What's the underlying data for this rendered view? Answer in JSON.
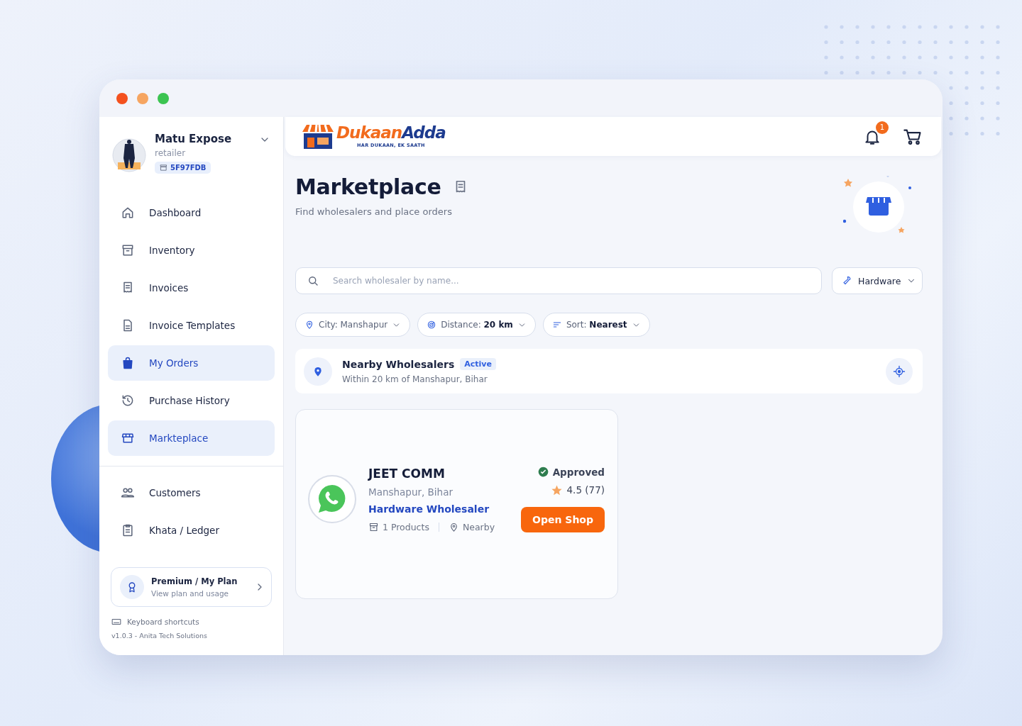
{
  "user": {
    "name": "Matu Expose",
    "role": "retailer",
    "code": "5F97FDB"
  },
  "sidebar": {
    "items": [
      {
        "label": "Dashboard",
        "selected": false
      },
      {
        "label": "Inventory",
        "selected": false
      },
      {
        "label": "Invoices",
        "selected": false
      },
      {
        "label": "Invoice Templates",
        "selected": false
      },
      {
        "label": "My Orders",
        "selected": true
      },
      {
        "label": "Purchase History",
        "selected": false
      },
      {
        "label": "Markteplace",
        "selected": true
      }
    ],
    "secondary_items": [
      {
        "label": "Customers",
        "selected": false
      },
      {
        "label": "Khata / Ledger",
        "selected": false
      }
    ],
    "plan": {
      "title": "Premium / My Plan",
      "subtitle": "View plan and usage"
    },
    "shortcuts": "Keyboard shortcuts",
    "version": "v1.0.3 - Anita Tech Solutions"
  },
  "header": {
    "logo": {
      "part_1": "Dukaan",
      "part_2": "Adda",
      "tagline": "HAR DUKAAN, EK SAATH"
    },
    "notifications": "1"
  },
  "page": {
    "title": "Marketplace",
    "subtitle": "Find wholesalers and place orders"
  },
  "search": {
    "placeholder": "Search wholesaler by name..."
  },
  "category": {
    "value": "Hardware"
  },
  "filters": [
    {
      "label": "City: Manshapur"
    },
    {
      "label": "Distance: **20 km**"
    },
    {
      "label": "Sort: **Nearest**"
    }
  ],
  "nearby": {
    "title": "Nearby Wholesalers",
    "badge": "Active",
    "subtitle": "Within 20 km of Manshapur, Bihar"
  },
  "shops": [
    {
      "name": "JEET COMM",
      "location": "Manshapur, Bihar",
      "category": "Hardware Wholesaler",
      "products": "1 Products",
      "distance": "Nearby",
      "status": "Approved",
      "rating": "4.5 (77)",
      "action": "Open Shop"
    }
  ]
}
